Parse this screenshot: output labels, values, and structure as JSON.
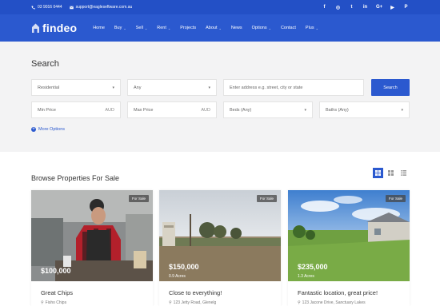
{
  "topbar": {
    "phone": "03 9016 0444",
    "email": "support@eagleseftware.com.au",
    "social": [
      "f",
      "◎",
      "t",
      "in",
      "G+",
      "▶",
      "P"
    ]
  },
  "header": {
    "logo": "findeo",
    "nav": [
      {
        "label": "Home",
        "chevron": false
      },
      {
        "label": "Buy",
        "chevron": true
      },
      {
        "label": "Sell",
        "chevron": true
      },
      {
        "label": "Rent",
        "chevron": true
      },
      {
        "label": "Projects",
        "chevron": false
      },
      {
        "label": "About",
        "chevron": true
      },
      {
        "label": "News",
        "chevron": false
      },
      {
        "label": "Options",
        "chevron": true
      },
      {
        "label": "Contact",
        "chevron": false
      },
      {
        "label": "Plus",
        "chevron": true
      }
    ]
  },
  "search": {
    "title": "Search",
    "type_value": "Residential",
    "any_value": "Any",
    "address_placeholder": "Enter address e.g. street, city or state",
    "search_label": "Search",
    "min_price_placeholder": "Min Price",
    "max_price_placeholder": "Max Price",
    "currency": "AUD",
    "beds_value": "Beds (Any)",
    "baths_value": "Baths (Any)",
    "more_options": "More Options"
  },
  "browse": {
    "title": "Browse Properties For Sale",
    "cards": [
      {
        "badge": "For Sale",
        "price": "$100,000",
        "area": "",
        "name": "Great Chips",
        "address": "Fisho Chips"
      },
      {
        "badge": "For Sale",
        "price": "$150,000",
        "area": "0.9 Acres",
        "name": "Close to everything!",
        "address": "123 Jetty Road, Glenelg"
      },
      {
        "badge": "For Sale",
        "price": "$235,000",
        "area": "1.3 Acres",
        "name": "Fantastic location, great price!",
        "address": "123 Jacone Drive, Sanctuary Lakes"
      }
    ]
  },
  "colors": {
    "brand": "#2b59cf",
    "topbar": "#2350c6"
  }
}
